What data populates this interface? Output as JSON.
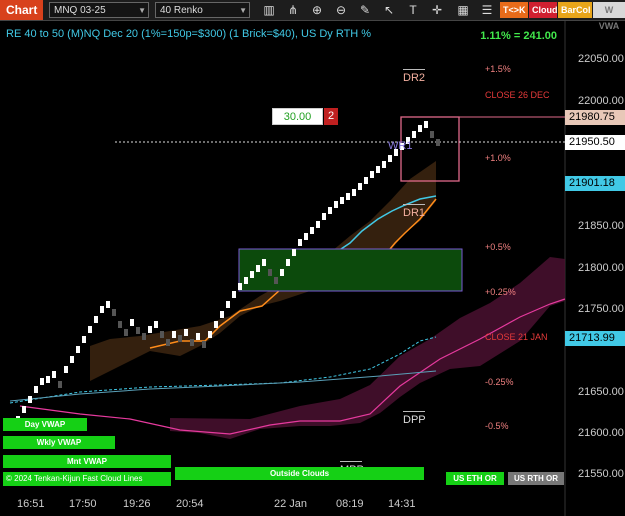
{
  "toolbar": {
    "title": "Chart",
    "instrument": "MNQ 03-25",
    "bar_type": "40 Renko",
    "btn_tk": "T<>K",
    "btn_cloud": "Cloud",
    "btn_barcol": "BarCol",
    "btn_vwap": "W VWA"
  },
  "header": {
    "info": "RE 40 to 50 (M)NQ Dec 20 (1%=150p=$300) (1 Brick=$40), US Dy RTH %",
    "pct": "1.11% = 241.00"
  },
  "annotations": {
    "p15": "+1.5%",
    "close26": "CLOSE 26 DEC",
    "p10": "+1.0%",
    "p05": "+0.5%",
    "p025": "+0.25%",
    "close21": "CLOSE 21 JAN",
    "m025": "-0.25%",
    "m05": "-0.5%"
  },
  "levels": {
    "dr2": "DR2",
    "dr1": "DR1",
    "dpp": "DPP",
    "mpp": "MPP",
    "wr1": "WR1"
  },
  "order_box": {
    "value": "30.00",
    "qty": "2"
  },
  "y_axis": [
    "22050.00",
    "22000.00",
    "21850.00",
    "21800.00",
    "21750.00",
    "21650.00",
    "21600.00",
    "21550.00"
  ],
  "price_tags": {
    "p1": "21980.75",
    "p2": "21950.50",
    "p3": "21901.18",
    "p4": "21713.99"
  },
  "x_axis": [
    "16:51",
    "17:50",
    "19:26",
    "20:54",
    "22 Jan",
    "08:19",
    "14:31"
  ],
  "legend_bars": {
    "day_vwap": "Day VWAP",
    "wkly_vwap": "Wkly VWAP",
    "mnt_vwap": "Mnt VWAP",
    "outside_clouds": "Outside Clouds",
    "us_eth_or": "US ETH OR",
    "us_rth_or": "US RTH OR",
    "cloud_lines": "© 2024 Tenkan-Kijun Fast Cloud Lines"
  },
  "colors": {
    "title_bg": "#d8411c",
    "accent_cyan": "#41c9e6",
    "accent_green": "#42e84c",
    "level_salmon": "#f08080",
    "tk_orange": "#ff8c1a",
    "cloud_red": "#d02030"
  }
}
